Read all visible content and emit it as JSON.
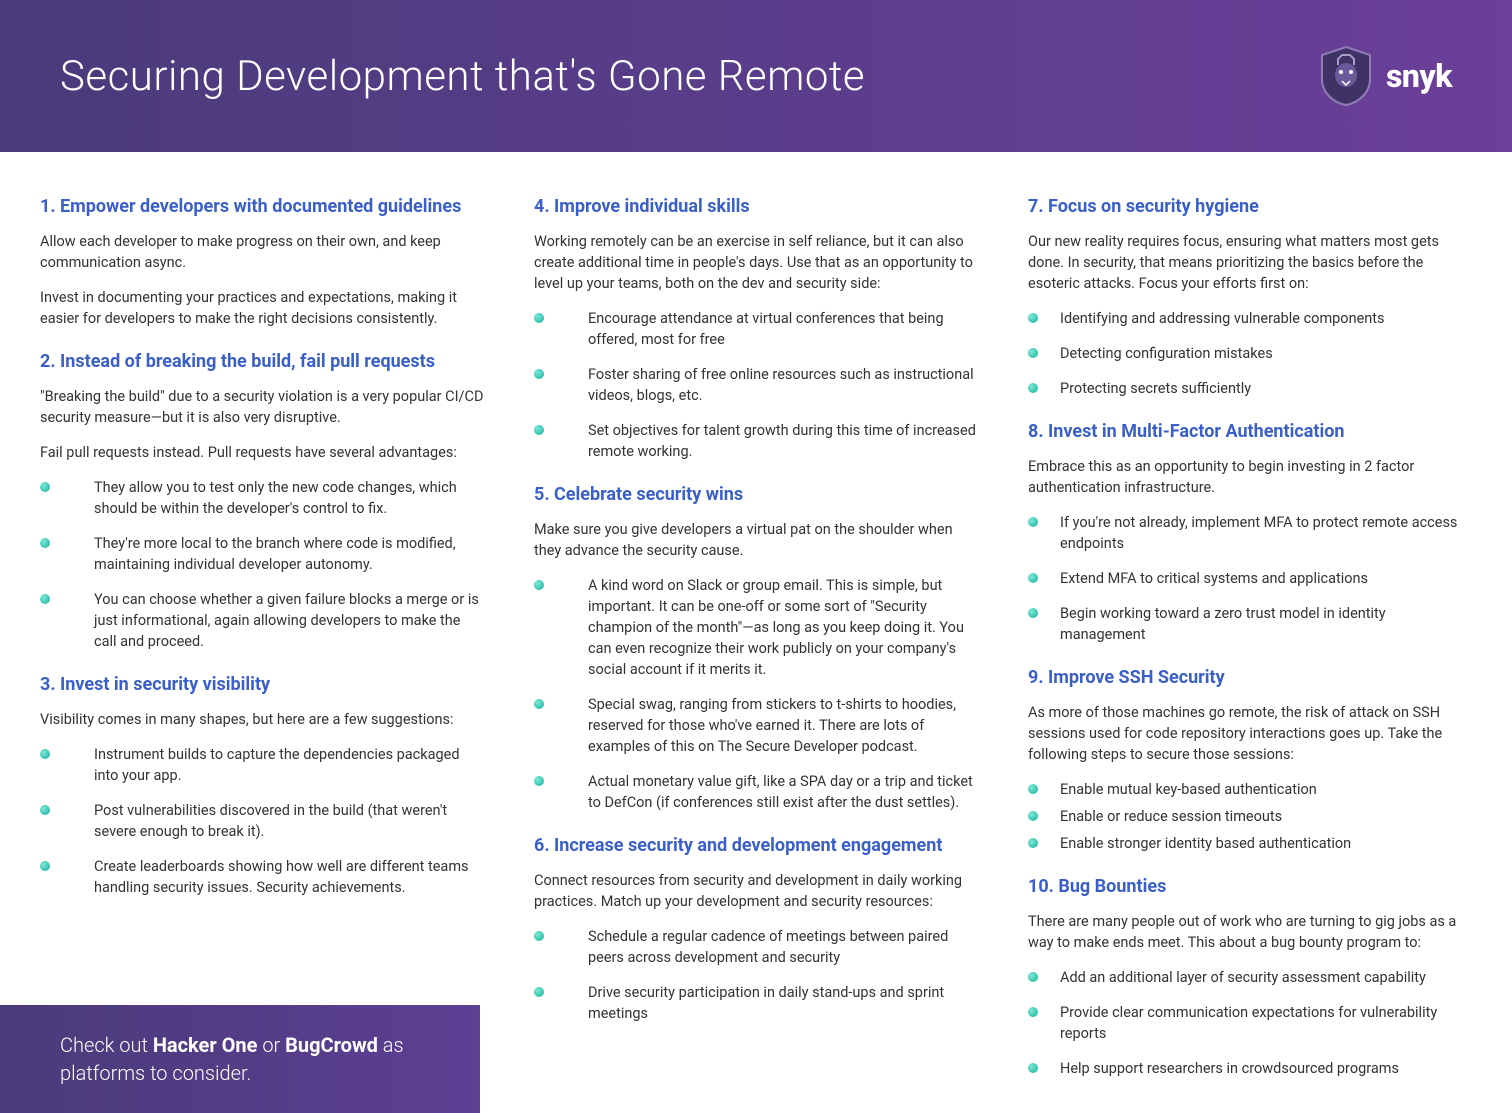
{
  "header": {
    "title": "Securing Development that's Gone Remote",
    "brand": "snyk"
  },
  "callout": {
    "prefix": "Check out ",
    "b1": "Hacker One",
    "mid": " or ",
    "b2": "BugCrowd",
    "suffix": " as platforms to consider."
  },
  "col1": {
    "s1": {
      "title": "1. Empower developers with documented guidelines",
      "p1": "Allow each developer to make progress on their own, and keep communication async.",
      "p2": "Invest in documenting your practices and expectations, making it easier for developers to make the right decisions consistently."
    },
    "s2": {
      "title": "2. Instead of breaking the build, fail pull requests",
      "p1": "\"Breaking the build\" due to a security violation is a very popular CI/CD security measure—but it is also very disruptive.",
      "p2": "Fail pull requests instead. Pull requests have several advantages:",
      "items": [
        "They allow you to test only the new code changes, which should be within the developer's control to fix.",
        "They're more local to the branch where code is modified, maintaining individual developer autonomy.",
        "You can choose whether a given failure blocks a merge or is just informational, again allowing developers to make the call and proceed."
      ]
    },
    "s3": {
      "title": "3. Invest in security visibility",
      "p1": "Visibility comes in many shapes, but here are a few suggestions:",
      "items": [
        "Instrument builds to capture the dependencies packaged into your app.",
        "Post vulnerabilities discovered in the build (that weren't severe enough to break it).",
        "Create leaderboards showing how well are different teams handling security issues. Security achievements."
      ]
    }
  },
  "col2": {
    "s4": {
      "title": "4.  Improve individual skills",
      "p1": "Working remotely can be an exercise in self reliance, but it can also create additional time in people's days. Use that as an opportunity to level up your teams, both on the dev and security side:",
      "items": [
        "Encourage attendance at virtual conferences that being offered, most for free",
        "Foster sharing of free online resources such as instructional videos, blogs, etc.",
        "Set objectives for talent growth during this time of increased remote working."
      ]
    },
    "s5": {
      "title": "5.  Celebrate security wins",
      "p1": "Make sure you give developers a virtual pat on the shoulder when they advance the security cause.",
      "items": [
        "A kind word on Slack or group email. This is simple, but important. It can be one-off or some sort of \"Security champion of the month\"—as long as you keep doing it. You can even recognize their work publicly on your company's social account if it merits it.",
        "Special swag, ranging from stickers to t-shirts to hoodies, reserved for those who've earned it. There are lots of examples of this on The Secure Developer podcast.",
        "Actual monetary value gift, like a SPA day or a trip and ticket to DefCon (if conferences still exist after the dust settles)."
      ]
    },
    "s6": {
      "title": "6.  Increase security and development engagement",
      "p1": "Connect resources from security and development in daily working practices. Match up your development and security resources:",
      "items": [
        "Schedule a regular cadence of meetings between paired peers across development and security",
        "Drive security participation in daily stand-ups and sprint meetings"
      ]
    }
  },
  "col3": {
    "s7": {
      "title": "7. Focus on security hygiene",
      "p1": "Our new reality requires focus, ensuring what matters most gets done. In security, that means prioritizing the basics before the esoteric attacks. Focus your efforts first on:",
      "items": [
        "Identifying and addressing vulnerable components",
        "Detecting configuration mistakes",
        "Protecting secrets sufficiently"
      ]
    },
    "s8": {
      "title": "8. Invest in Multi-Factor Authentication",
      "p1": "Embrace this as an opportunity to begin investing in 2 factor authentication infrastructure.",
      "items": [
        "If you're not already, implement MFA to protect remote access endpoints",
        "Extend MFA to critical systems and applications",
        "Begin working toward a zero trust model in identity management"
      ]
    },
    "s9": {
      "title": "9. Improve SSH Security",
      "p1": "As more of those machines go remote, the risk of attack on SSH sessions used for code repository interactions goes up. Take the following steps to secure those sessions:",
      "items": [
        "Enable mutual key-based authentication",
        "Enable or reduce session timeouts",
        "Enable stronger identity based authentication"
      ]
    },
    "s10": {
      "title": "10.  Bug Bounties",
      "p1": "There are many people out of work who are turning to gig jobs as a way to make ends meet. This about a bug bounty program to:",
      "items": [
        "Add an additional layer of security assessment capability",
        "Provide clear communication expectations for vulnerability reports",
        "Help support researchers in crowdsourced programs"
      ]
    }
  }
}
